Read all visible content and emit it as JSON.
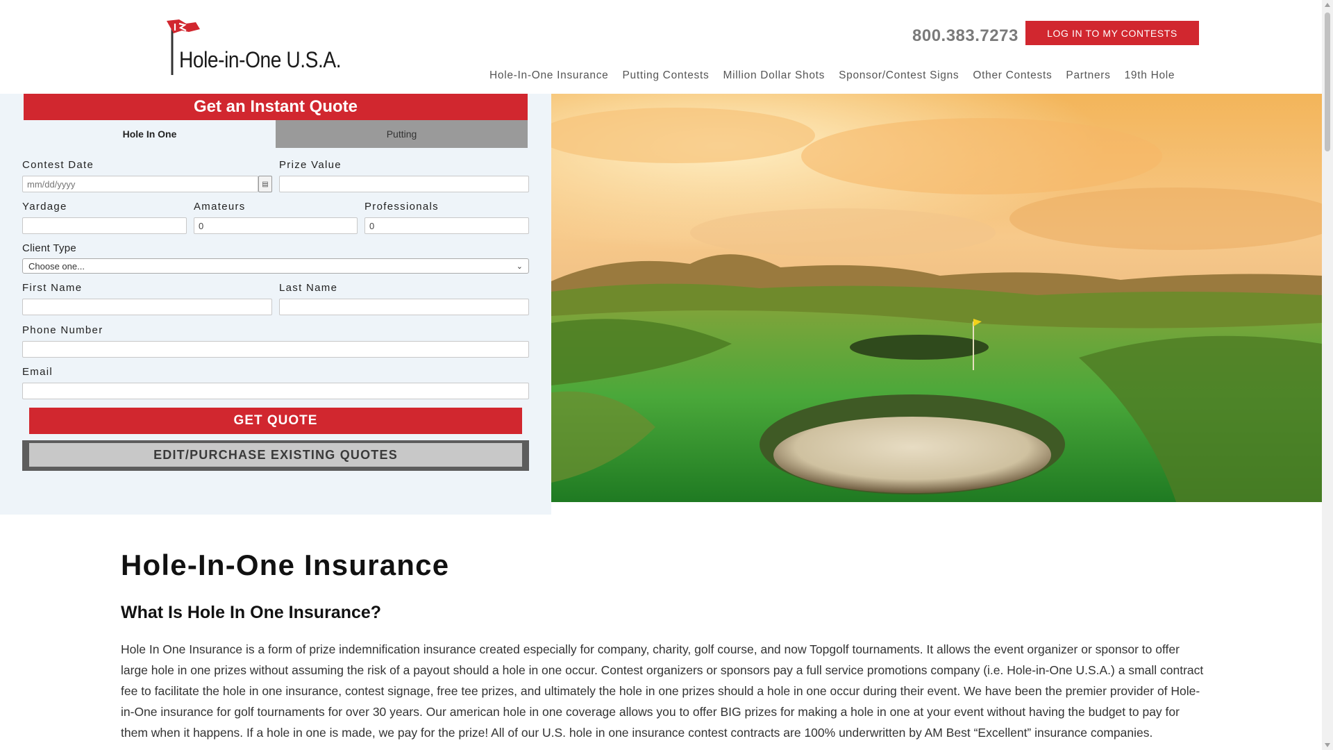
{
  "header": {
    "logo_text": "Hole-in-One U.S.A.",
    "phone": "800.383.7273",
    "login_label": "LOG IN TO MY CONTESTS",
    "nav": [
      "Hole-In-One Insurance",
      "Putting Contests",
      "Million Dollar Shots",
      "Sponsor/Contest Signs",
      "Other Contests",
      "Partners",
      "19th Hole"
    ]
  },
  "quote": {
    "title": "Get an Instant Quote",
    "tabs": [
      "Hole In One",
      "Putting"
    ],
    "active_tab": "Hole In One",
    "contest_date": {
      "label": "Contest Date",
      "placeholder": "mm/dd/yyyy"
    },
    "prize_value": {
      "label": "Prize Value",
      "value": ""
    },
    "yardage": {
      "label": "Yardage",
      "value": ""
    },
    "amateurs": {
      "label": "Amateurs",
      "value": "0"
    },
    "professionals": {
      "label": "Professionals",
      "value": "0"
    },
    "client_type": {
      "label": "Client Type",
      "selected": "Choose one..."
    },
    "first_name": {
      "label": "First Name",
      "value": ""
    },
    "last_name": {
      "label": "Last Name",
      "value": ""
    },
    "phone_number": {
      "label": "Phone Number",
      "value": ""
    },
    "email": {
      "label": "Email",
      "value": ""
    },
    "get_quote_label": "GET QUOTE",
    "edit_label": "EDIT/PURCHASE EXISTING QUOTES"
  },
  "content": {
    "heading": "Hole-In-One Insurance",
    "subheading": "What Is Hole In One Insurance?",
    "paragraph": "Hole In One Insurance is a form of prize indemnification insurance created especially for company, charity, golf course, and now Topgolf tournaments. It allows the event organizer or sponsor to offer large hole in one prizes without assuming the risk of a payout should a hole in one occur. Contest organizers or sponsors pay a full service promotions company (i.e. Hole-in-One U.S.A.) a small contract fee to facilitate the hole in one insurance, contest signage, free tee prizes, and ultimately the hole in one prizes should a hole in one occur during their event. We have been the premier provider of Hole-in-One insurance for golf tournaments for over 30 years. Our american hole in one coverage allows you to offer BIG prizes for making a hole in one at your event without having the budget to pay for them when it happens. If a hole in one is made, we pay for the prize! All of our U.S. hole in one insurance contest contracts are 100% underwritten by AM Best “Excellent” insurance companies."
  },
  "colors": {
    "brand_red": "#d1272f",
    "panel_bg": "#eef4f9",
    "tab_inactive": "#9a9a9a",
    "edit_button": "#c8c8c8"
  },
  "icons": {
    "logo": "flag-logo-icon",
    "calendar": "calendar-icon",
    "select": "chevron-down-icon"
  }
}
